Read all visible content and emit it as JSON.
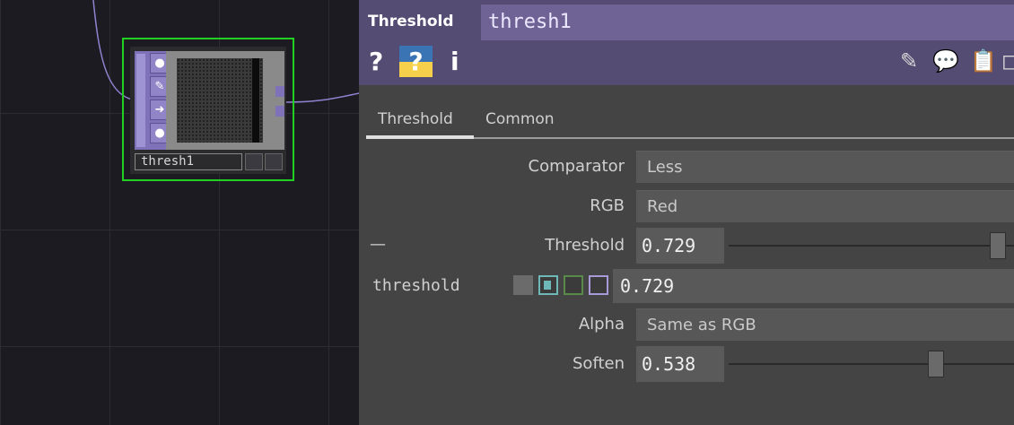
{
  "node": {
    "name": "thresh1",
    "family_color": "#7f72b8",
    "selected_color": "#22d022"
  },
  "panel": {
    "op_type": "Threshold",
    "op_name": "thresh1",
    "header_buttons": {
      "help": "?",
      "python_help": "?",
      "info": "i"
    },
    "header_icons": [
      "pencil-icon",
      "comment-icon",
      "clipboard-icon"
    ],
    "tabs": [
      {
        "label": "Threshold",
        "active": true
      },
      {
        "label": "Common",
        "active": false
      }
    ],
    "params": {
      "comparator": {
        "label": "Comparator",
        "value": "Less"
      },
      "rgb": {
        "label": "RGB",
        "value": "Red"
      },
      "threshold": {
        "label": "Threshold",
        "value": "0.729",
        "collapse_glyph": "—",
        "slider_fraction": 0.97
      },
      "threshold_expr": {
        "name": "threshold",
        "value": "0.729"
      },
      "alpha": {
        "label": "Alpha",
        "value": "Same as RGB"
      },
      "soften": {
        "label": "Soften",
        "value": "0.538",
        "slider_fraction": 0.74
      }
    }
  }
}
